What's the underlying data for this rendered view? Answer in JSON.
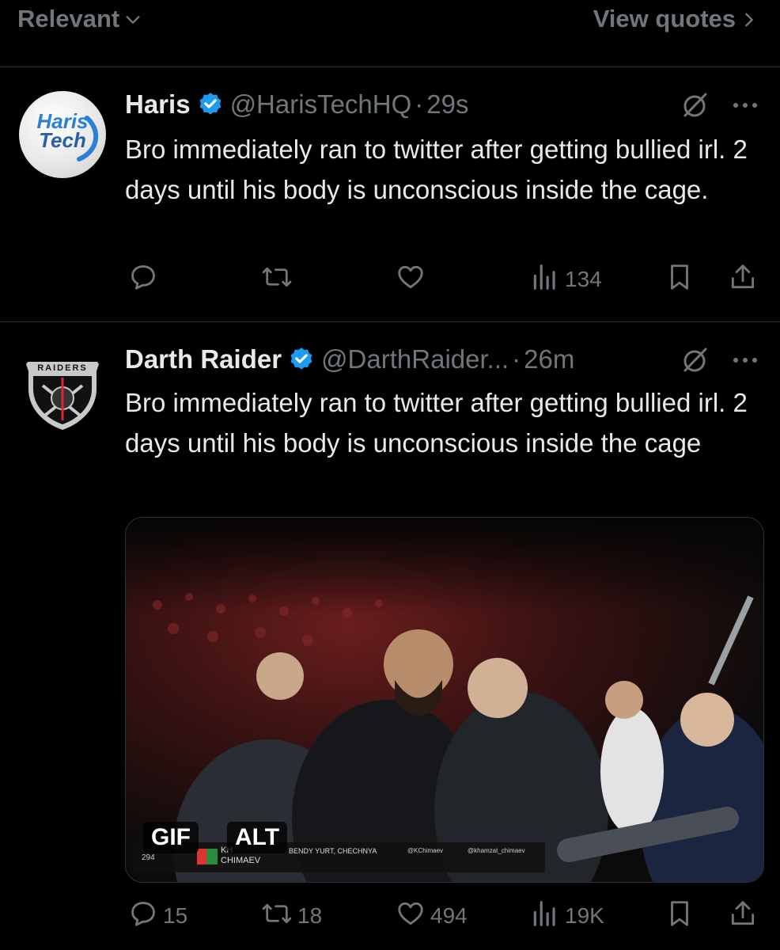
{
  "header": {
    "sort_label": "Relevant",
    "quotes_label": "View quotes"
  },
  "posts": [
    {
      "avatar_text_top": "Haris",
      "avatar_text_bottom": "Tech",
      "name": "Haris",
      "handle": "@HarisTechHQ",
      "separator": "·",
      "time": "29s",
      "text": "Bro immediately ran to twitter after getting bullied irl. 2 days until his body is unconscious inside the cage.",
      "actions": {
        "replies": "",
        "reposts": "",
        "likes": "",
        "views": "134"
      }
    },
    {
      "avatar_text": "RAIDERS",
      "name": "Darth Raider",
      "handle": "@DarthRaider...",
      "separator": "·",
      "time": "26m",
      "text": "Bro immediately ran to twitter after getting bullied irl. 2 days until his body is unconscious inside the cage",
      "media": {
        "gif_label": "GIF",
        "alt_label": "ALT",
        "overlay_name_top": "KH",
        "overlay_name_bottom": "CHIMAEV",
        "overlay_ticker": "BENDY YURT, CHECHNYA",
        "overlay_handle_1": "@KChimaev",
        "overlay_handle_2": "@khamzat_chimaev",
        "overlay_number": "294"
      },
      "actions": {
        "replies": "15",
        "reposts": "18",
        "likes": "494",
        "views": "19K"
      }
    }
  ],
  "colors": {
    "background": "#000000",
    "text": "#e7e9ea",
    "muted": "#71767b",
    "divider": "#2f3336",
    "verified": "#1d9bf0"
  },
  "icons": [
    "chevron-down-icon",
    "chevron-right-icon",
    "verified-icon",
    "grok-icon",
    "more-icon",
    "reply-icon",
    "repost-icon",
    "like-icon",
    "views-icon",
    "bookmark-icon",
    "share-icon"
  ]
}
